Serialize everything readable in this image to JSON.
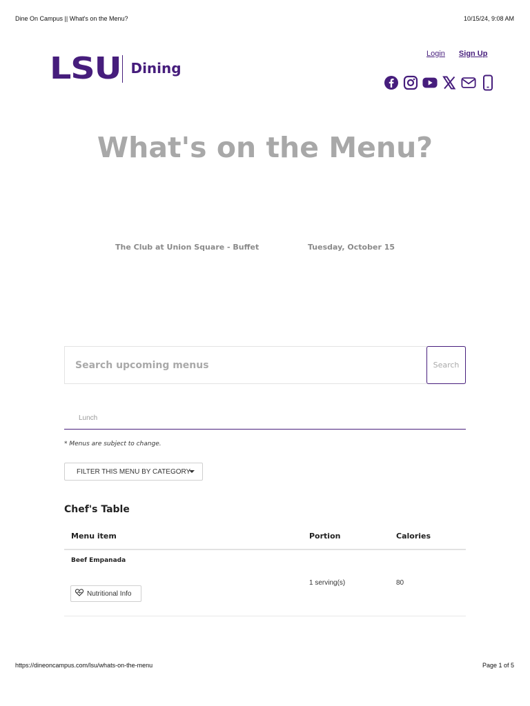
{
  "print_header": {
    "title": "Dine On Campus || What's on the Menu?",
    "datetime": "10/15/24, 9:08 AM"
  },
  "print_footer": {
    "url": "https://dineoncampus.com/lsu/whats-on-the-menu",
    "page": "Page 1 of 5"
  },
  "brand": {
    "logo_text": "LSU",
    "sub_text": "Dining",
    "color": "#461d7c"
  },
  "auth": {
    "login": "Login",
    "signup": "Sign Up"
  },
  "social_icons": [
    "facebook-icon",
    "instagram-icon",
    "youtube-icon",
    "x-icon",
    "email-icon",
    "mobile-icon"
  ],
  "hero": {
    "title": "What's on the Menu?"
  },
  "selectors": {
    "location": "The Club at Union Square - Buffet",
    "date": "Tuesday, October 15"
  },
  "search": {
    "placeholder": "Search upcoming menus",
    "button_label": "Search"
  },
  "meal": {
    "selected": "Lunch"
  },
  "disclaimer": "* Menus are subject to change.",
  "filter": {
    "label": "FILTER THIS MENU BY CATEGORY"
  },
  "menu": {
    "section": "Chef's Table",
    "columns": {
      "item": "Menu item",
      "portion": "Portion",
      "calories": "Calories"
    },
    "rows": [
      {
        "name": "Beef Empanada",
        "portion": "1 serving(s)",
        "calories": "80",
        "nutrition_label": "Nutritional Info"
      }
    ]
  }
}
